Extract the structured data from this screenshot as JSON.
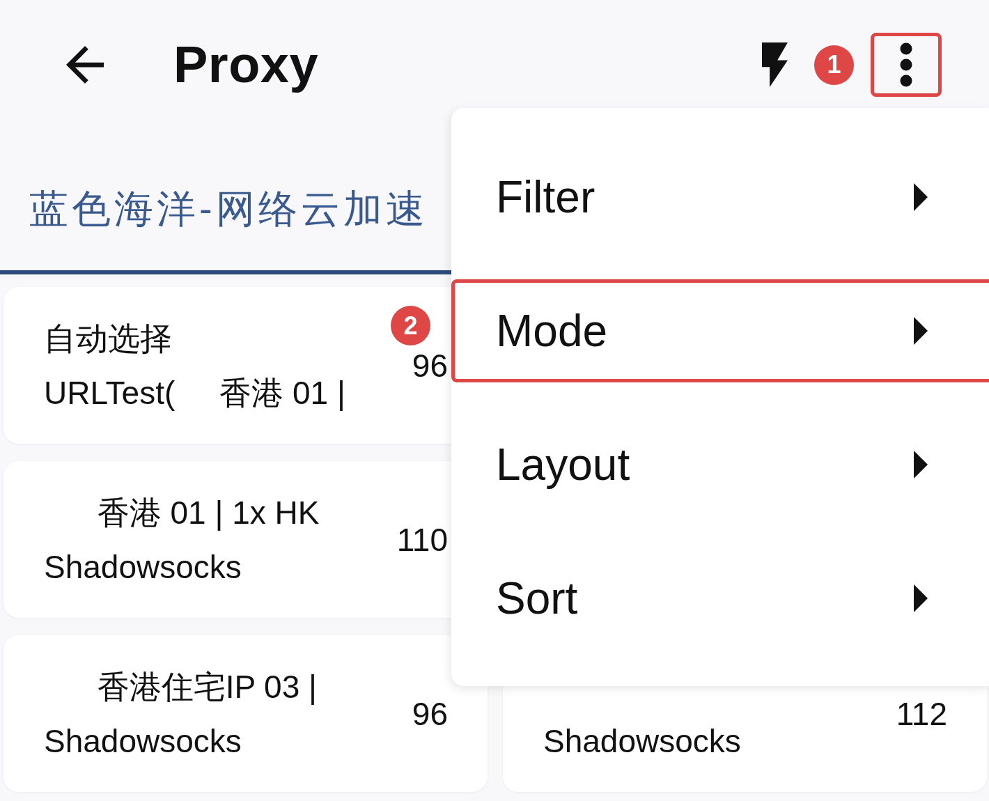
{
  "toolbar": {
    "title": "Proxy",
    "actions": [
      {
        "kind": "flash"
      },
      {
        "kind": "step_marker",
        "label": "1"
      },
      {
        "kind": "more",
        "highlighted": true
      }
    ]
  },
  "tabs": [
    {
      "label": "蓝色海洋-网络云加速",
      "selected": true
    }
  ],
  "proxy_rows": [
    [
      {
        "title": "自动选择",
        "subtitle": "URLTest(     香港 01 |",
        "delay": "96"
      }
    ],
    [
      {
        "title": "      香港 01 | 1x HK",
        "subtitle": "Shadowsocks",
        "delay": "110"
      }
    ],
    [
      {
        "title": "      香港住宅IP 03 |",
        "subtitle": "Shadowsocks",
        "delay": "96"
      },
      {
        "subtitle": "Shadowsocks",
        "delay": "112"
      }
    ]
  ],
  "menu": {
    "items": [
      {
        "label": "Filter",
        "submenu": true,
        "highlighted": false
      },
      {
        "label": "Mode",
        "submenu": true,
        "highlighted": true,
        "step_marker": "2"
      },
      {
        "label": "Layout",
        "submenu": true,
        "highlighted": false
      },
      {
        "label": "Sort",
        "submenu": true,
        "highlighted": false
      }
    ]
  }
}
